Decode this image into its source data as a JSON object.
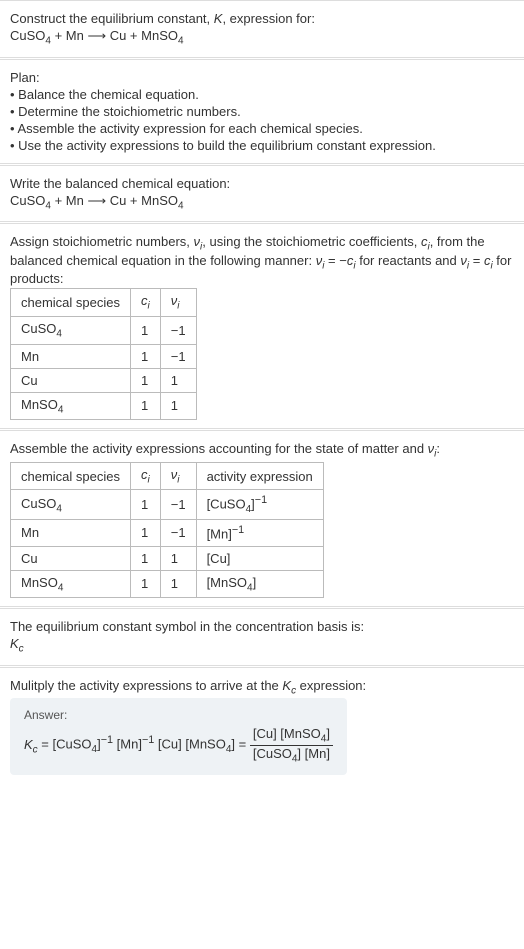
{
  "section1": {
    "title": "Construct the equilibrium constant, K, expression for:",
    "equation": "CuSO₄ + Mn ⟶ Cu + MnSO₄"
  },
  "section2": {
    "title": "Plan:",
    "b1": "• Balance the chemical equation.",
    "b2": "• Determine the stoichiometric numbers.",
    "b3": "• Assemble the activity expression for each chemical species.",
    "b4": "• Use the activity expressions to build the equilibrium constant expression."
  },
  "section3": {
    "title": "Write the balanced chemical equation:",
    "equation": "CuSO₄ + Mn ⟶ Cu + MnSO₄"
  },
  "section4": {
    "intro1": "Assign stoichiometric numbers, νᵢ, using the stoichiometric coefficients, cᵢ, from",
    "intro2": "the balanced chemical equation in the following manner: νᵢ = −cᵢ for reactants",
    "intro3": "and νᵢ = cᵢ for products:",
    "headers": [
      "chemical species",
      "cᵢ",
      "νᵢ"
    ],
    "rows": [
      [
        "CuSO₄",
        "1",
        "−1"
      ],
      [
        "Mn",
        "1",
        "−1"
      ],
      [
        "Cu",
        "1",
        "1"
      ],
      [
        "MnSO₄",
        "1",
        "1"
      ]
    ]
  },
  "section5": {
    "intro": "Assemble the activity expressions accounting for the state of matter and νᵢ:",
    "headers": [
      "chemical species",
      "cᵢ",
      "νᵢ",
      "activity expression"
    ],
    "rows": [
      [
        "CuSO₄",
        "1",
        "−1",
        "[CuSO₄]⁻¹"
      ],
      [
        "Mn",
        "1",
        "−1",
        "[Mn]⁻¹"
      ],
      [
        "Cu",
        "1",
        "1",
        "[Cu]"
      ],
      [
        "MnSO₄",
        "1",
        "1",
        "[MnSO₄]"
      ]
    ]
  },
  "section6": {
    "line1": "The equilibrium constant symbol in the concentration basis is:",
    "line2": "K꜀"
  },
  "section7": {
    "intro": "Mulitply the activity expressions to arrive at the K꜀ expression:",
    "answer_label": "Answer:",
    "lhs": "K꜀ = [CuSO₄]⁻¹ [Mn]⁻¹ [Cu] [MnSO₄] = ",
    "num": "[Cu] [MnSO₄]",
    "den": "[CuSO₄] [Mn]"
  },
  "chart_data": {
    "type": "table",
    "tables": [
      {
        "title": "Stoichiometric numbers",
        "columns": [
          "chemical species",
          "cᵢ",
          "νᵢ"
        ],
        "rows": [
          {
            "chemical species": "CuSO₄",
            "cᵢ": 1,
            "νᵢ": -1
          },
          {
            "chemical species": "Mn",
            "cᵢ": 1,
            "νᵢ": -1
          },
          {
            "chemical species": "Cu",
            "cᵢ": 1,
            "νᵢ": 1
          },
          {
            "chemical species": "MnSO₄",
            "cᵢ": 1,
            "νᵢ": 1
          }
        ]
      },
      {
        "title": "Activity expressions",
        "columns": [
          "chemical species",
          "cᵢ",
          "νᵢ",
          "activity expression"
        ],
        "rows": [
          {
            "chemical species": "CuSO₄",
            "cᵢ": 1,
            "νᵢ": -1,
            "activity expression": "[CuSO₄]⁻¹"
          },
          {
            "chemical species": "Mn",
            "cᵢ": 1,
            "νᵢ": -1,
            "activity expression": "[Mn]⁻¹"
          },
          {
            "chemical species": "Cu",
            "cᵢ": 1,
            "νᵢ": 1,
            "activity expression": "[Cu]"
          },
          {
            "chemical species": "MnSO₄",
            "cᵢ": 1,
            "νᵢ": 1,
            "activity expression": "[MnSO₄]"
          }
        ]
      }
    ]
  }
}
